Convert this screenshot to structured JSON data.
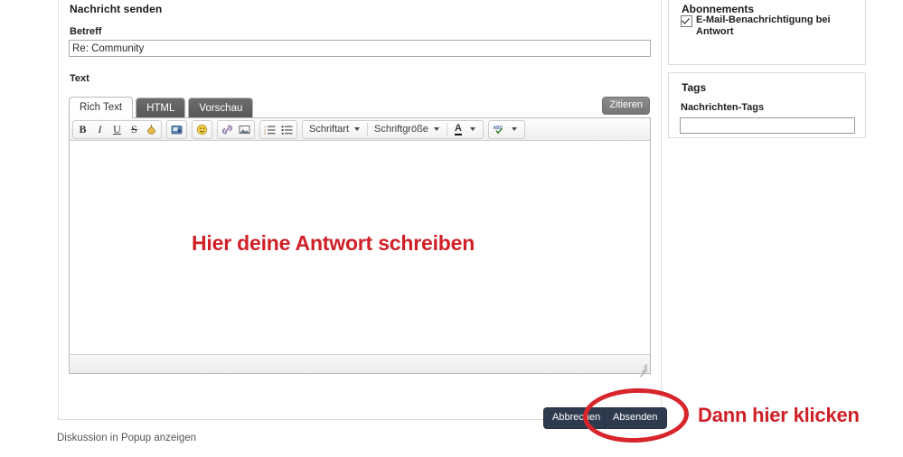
{
  "form": {
    "panel_title": "Nachricht senden",
    "subject_label": "Betreff",
    "subject_value": "Re: Community",
    "subject_placeholder": "",
    "text_label": "Text",
    "quote_button": "Zitieren",
    "tabs": [
      {
        "label": "Rich Text",
        "active": true
      },
      {
        "label": "HTML",
        "active": false
      },
      {
        "label": "Vorschau",
        "active": false
      }
    ],
    "toolbar": {
      "bold": "B",
      "italic": "I",
      "underline": "U",
      "strikethrough": "S",
      "highlight_icon": "highlight-color-icon",
      "media_icon": "insert-media-icon",
      "smiley_icon": "smiley-icon",
      "link_icon": "link-icon",
      "image_icon": "image-icon",
      "ordered_list_icon": "ordered-list-icon",
      "unordered_list_icon": "unordered-list-icon",
      "font_family_label": "Schriftart",
      "font_size_label": "Schriftgröße",
      "font_color_label": "A",
      "spellcheck_label": "ABC"
    },
    "editor_annotation": "Hier deine Antwort schreiben"
  },
  "footer": {
    "cancel_button": "Abbrechen",
    "submit_button": "Absenden",
    "popup_link": "Diskussion in Popup anzeigen"
  },
  "annotation": {
    "callout_text": "Dann hier klicken",
    "highlight_color": "#d8242b",
    "text_color": "#cf2027"
  },
  "sidebar": {
    "subscriptions": {
      "title": "Abonnements",
      "checkbox_label": "E-Mail-Benachrichtigung bei Antwort",
      "checked": true
    },
    "tags": {
      "title": "Tags",
      "field_label": "Nachrichten-Tags",
      "value": "",
      "placeholder": ""
    }
  }
}
